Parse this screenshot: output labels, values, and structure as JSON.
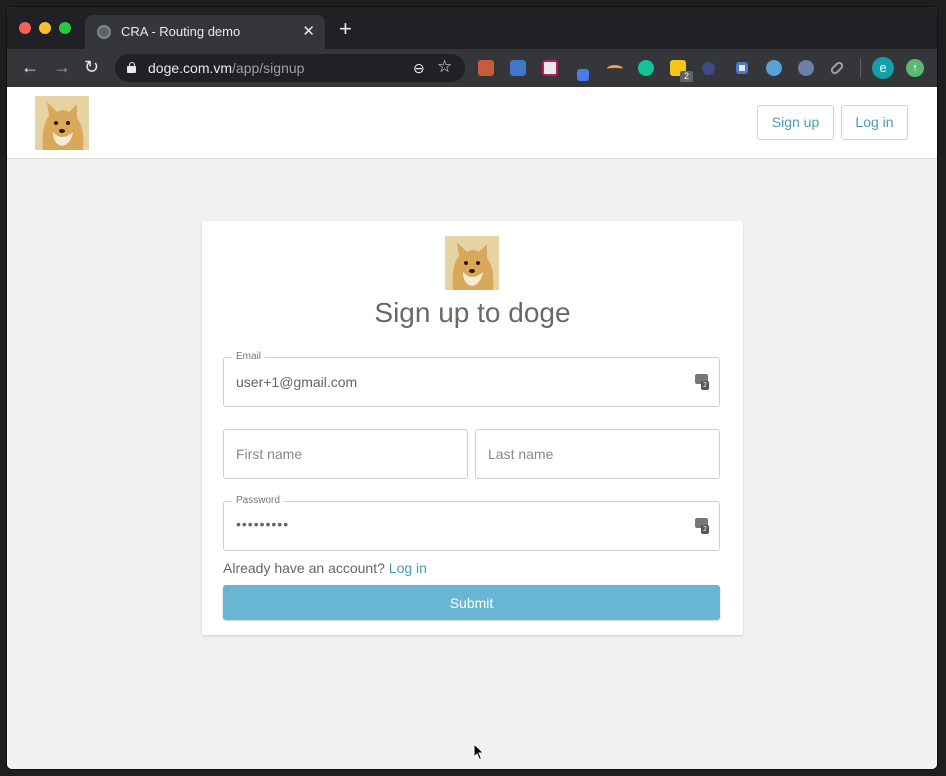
{
  "browser": {
    "tab_title": "CRA - Routing demo",
    "url_host": "doge.com.vm",
    "url_path": "/app/signup",
    "extension_badge": "2",
    "profile_initial": "e",
    "extension_icons": [
      "ext-icon-1",
      "ext-icon-2",
      "ext-icon-3",
      "ext-icon-4",
      "ext-icon-5",
      "grammarly-icon",
      "sticky-note-icon",
      "ext-icon-8",
      "ext-icon-9",
      "fps-icon",
      "ext-icon-11",
      "link-icon"
    ]
  },
  "header": {
    "signup_label": "Sign up",
    "login_label": "Log in"
  },
  "form": {
    "title": "Sign up to doge",
    "email_legend": "Email",
    "email_value": "user+1@gmail.com",
    "first_name_placeholder": "First name",
    "last_name_placeholder": "Last name",
    "password_legend": "Password",
    "password_value": "•••••••••",
    "already_text": "Already have an account?",
    "login_link": "Log in",
    "submit_label": "Submit"
  },
  "colors": {
    "accent": "#68b6d3",
    "link": "#4a9bb7"
  }
}
